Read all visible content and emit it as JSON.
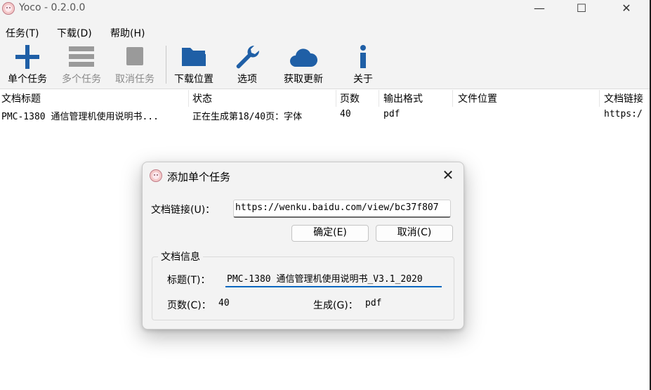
{
  "window": {
    "title": "Yoco - 0.2.0.0",
    "controls": {
      "minimize": "—",
      "maximize": "☐",
      "close": "✕"
    }
  },
  "menu": [
    "任务(T)",
    "下载(D)",
    "帮助(H)"
  ],
  "toolbar": {
    "items": [
      {
        "label": "单个任务",
        "icon": "plus-icon",
        "enabled": true
      },
      {
        "label": "多个任务",
        "icon": "list-icon",
        "enabled": false
      },
      {
        "label": "取消任务",
        "icon": "stop-icon",
        "enabled": false
      },
      {
        "label": "下载位置",
        "icon": "folder-icon",
        "enabled": true
      },
      {
        "label": "选项",
        "icon": "wrench-icon",
        "enabled": true
      },
      {
        "label": "获取更新",
        "icon": "cloud-icon",
        "enabled": true
      },
      {
        "label": "关于",
        "icon": "info-icon",
        "enabled": true
      }
    ]
  },
  "table": {
    "columns": [
      "文档标题",
      "状态",
      "页数",
      "输出格式",
      "文件位置",
      "文档链接"
    ],
    "rows": [
      [
        "PMC-1380 通信管理机使用说明书...",
        "正在生成第18/40页：字体",
        "40",
        "pdf",
        "",
        "https:/"
      ]
    ]
  },
  "dialog": {
    "title": "添加单个任务",
    "url_label": "文档链接(U)：",
    "url_value": "https://wenku.baidu.com/view/bc37f807",
    "ok_label": "确定(E)",
    "cancel_label": "取消(C)",
    "info_legend": "文档信息",
    "title_label": "标题(T)：",
    "title_value": "PMC-1380 通信管理机使用说明书_V3.1_2020",
    "pages_label": "页数(C)：",
    "pages_value": "40",
    "format_label": "生成(G)：",
    "format_value": "pdf"
  },
  "colors": {
    "accent": "#0067c0",
    "toolbar_blue": "#1f5fa6"
  }
}
